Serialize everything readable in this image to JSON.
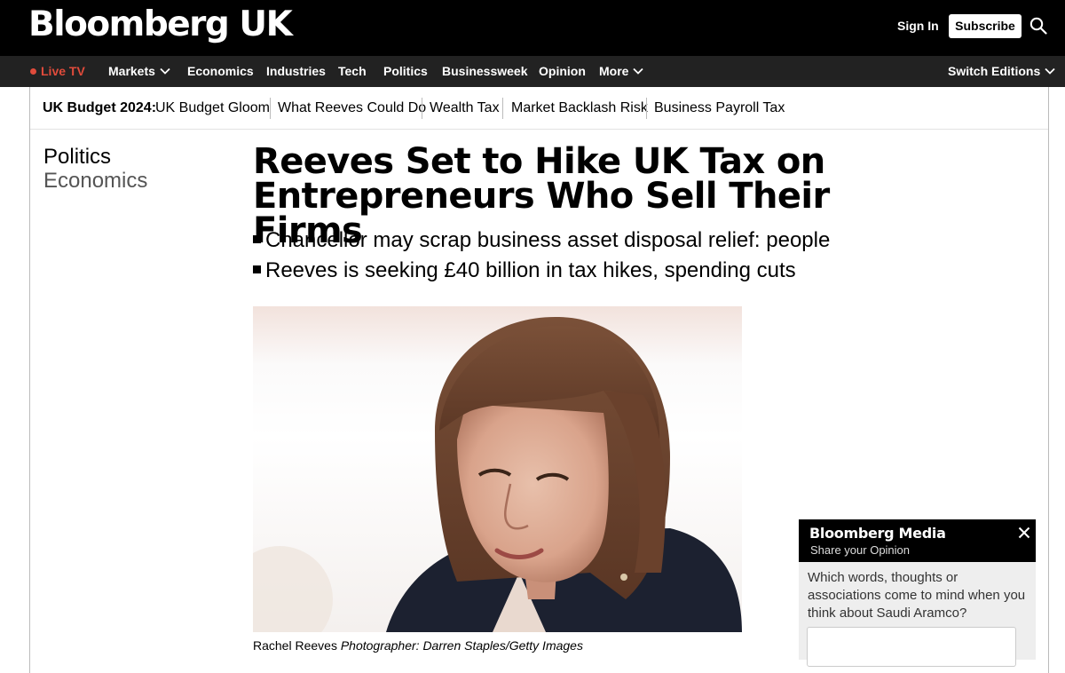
{
  "header": {
    "logo": "Bloomberg UK",
    "sign_in": "Sign In",
    "subscribe": "Subscribe"
  },
  "nav": {
    "live_tv": "Live TV",
    "markets": "Markets",
    "economics": "Economics",
    "industries": "Industries",
    "tech": "Tech",
    "politics": "Politics",
    "businessweek": "Businessweek",
    "opinion": "Opinion",
    "more": "More",
    "switch_editions": "Switch Editions"
  },
  "budget_bar": {
    "label": "UK Budget 2024:",
    "links": [
      "UK Budget Gloom",
      "What Reeves Could Do",
      "Wealth Tax",
      "Market Backlash Risk",
      "Business Payroll Tax"
    ]
  },
  "article": {
    "tags": [
      "Politics",
      "Economics"
    ],
    "headline": "Reeves Set to Hike UK Tax on Entrepreneurs Who Sell Their Firms",
    "bullets": [
      "Chancellor may scrap business asset disposal relief: people",
      "Reeves is seeking £40 billion in tax hikes, spending cuts"
    ],
    "caption_name": "Rachel Reeves",
    "caption_credit": "Photographer: Darren Staples/Getty Images"
  },
  "survey": {
    "title": "Bloomberg Media",
    "subtitle": "Share your Opinion",
    "question": "Which words, thoughts or associations come to mind when you think about Saudi Aramco?"
  },
  "colors": {
    "live_accent": "#e04b3b",
    "topbar": "#000000",
    "navbar": "#222222"
  }
}
